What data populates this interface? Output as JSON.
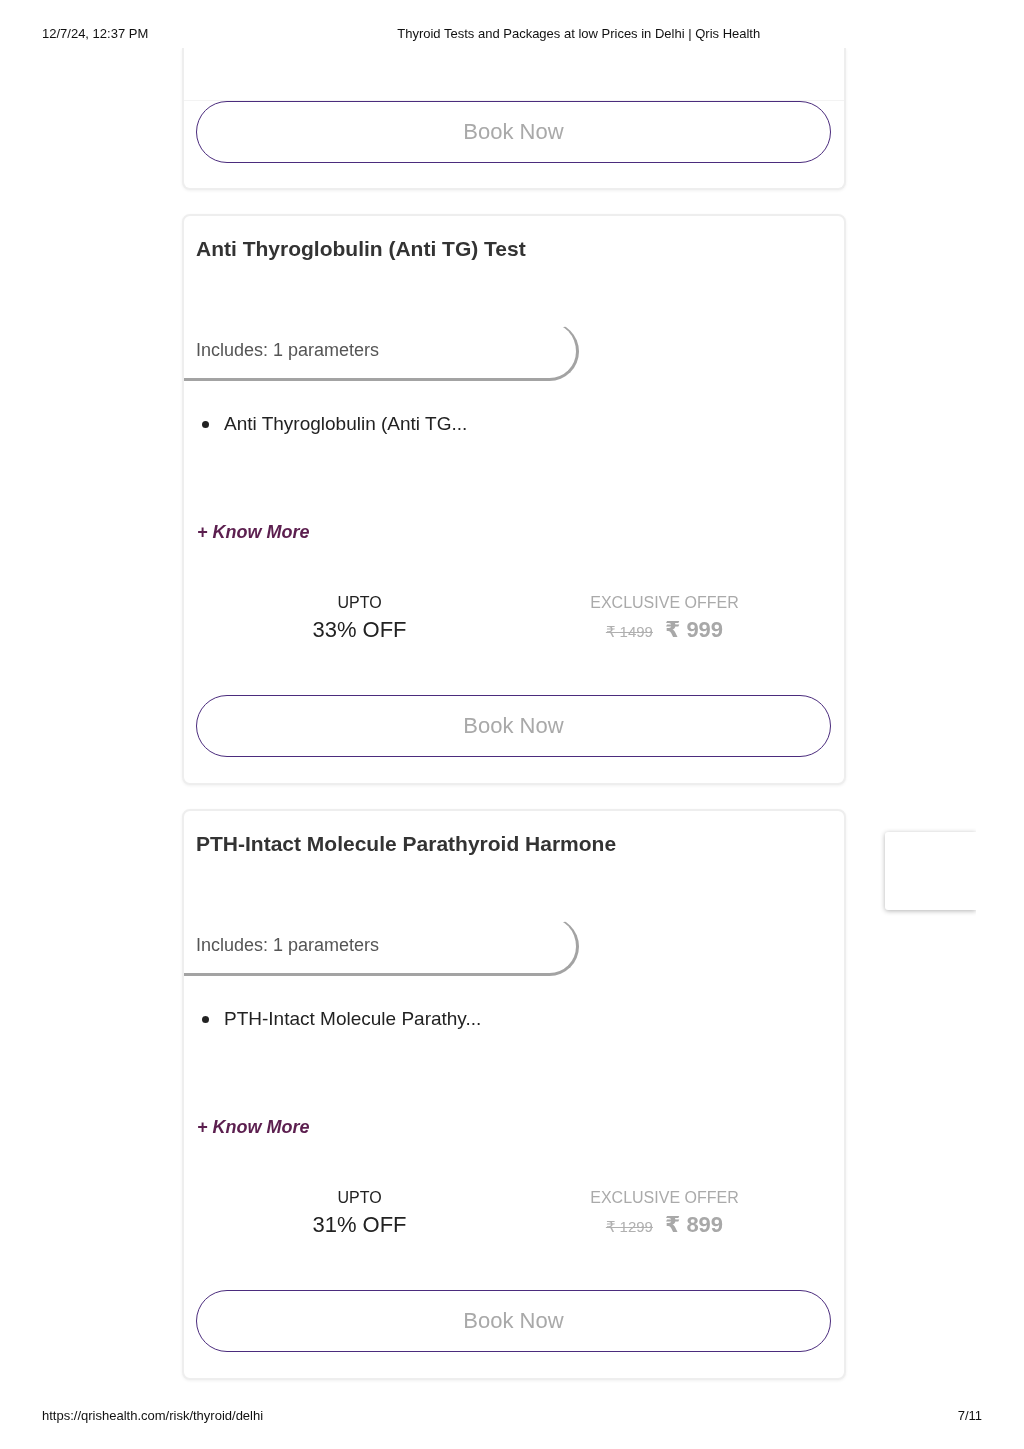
{
  "header": {
    "date": "12/7/24, 12:37 PM",
    "title": "Thyroid Tests and Packages at low Prices in Delhi | Qris Health"
  },
  "cards": [
    {
      "kind": "partial",
      "button": "Book Now"
    },
    {
      "kind": "full",
      "title": "Anti Thyroglobulin (Anti TG) Test",
      "includes": "Includes: 1 parameters",
      "parameters": [
        "Anti Thyroglobulin (Anti TG..."
      ],
      "know_more": "+ Know More",
      "discount_label": "UPTO",
      "discount": "33% OFF",
      "offer_label": "EXCLUSIVE OFFER",
      "old_price": "₹ 1499",
      "price": "₹ 999",
      "button": "Book Now"
    },
    {
      "kind": "full",
      "title": "PTH-Intact Molecule Parathyroid Harmone",
      "includes": "Includes: 1 parameters",
      "parameters": [
        "PTH-Intact Molecule Parathy..."
      ],
      "know_more": "+ Know More",
      "discount_label": "UPTO",
      "discount": "31% OFF",
      "offer_label": "EXCLUSIVE OFFER",
      "old_price": "₹ 1299",
      "price": "₹ 899",
      "button": "Book Now"
    }
  ],
  "footer": {
    "url": "https://qrishealth.com/risk/thyroid/delhi",
    "page": "7/11"
  }
}
